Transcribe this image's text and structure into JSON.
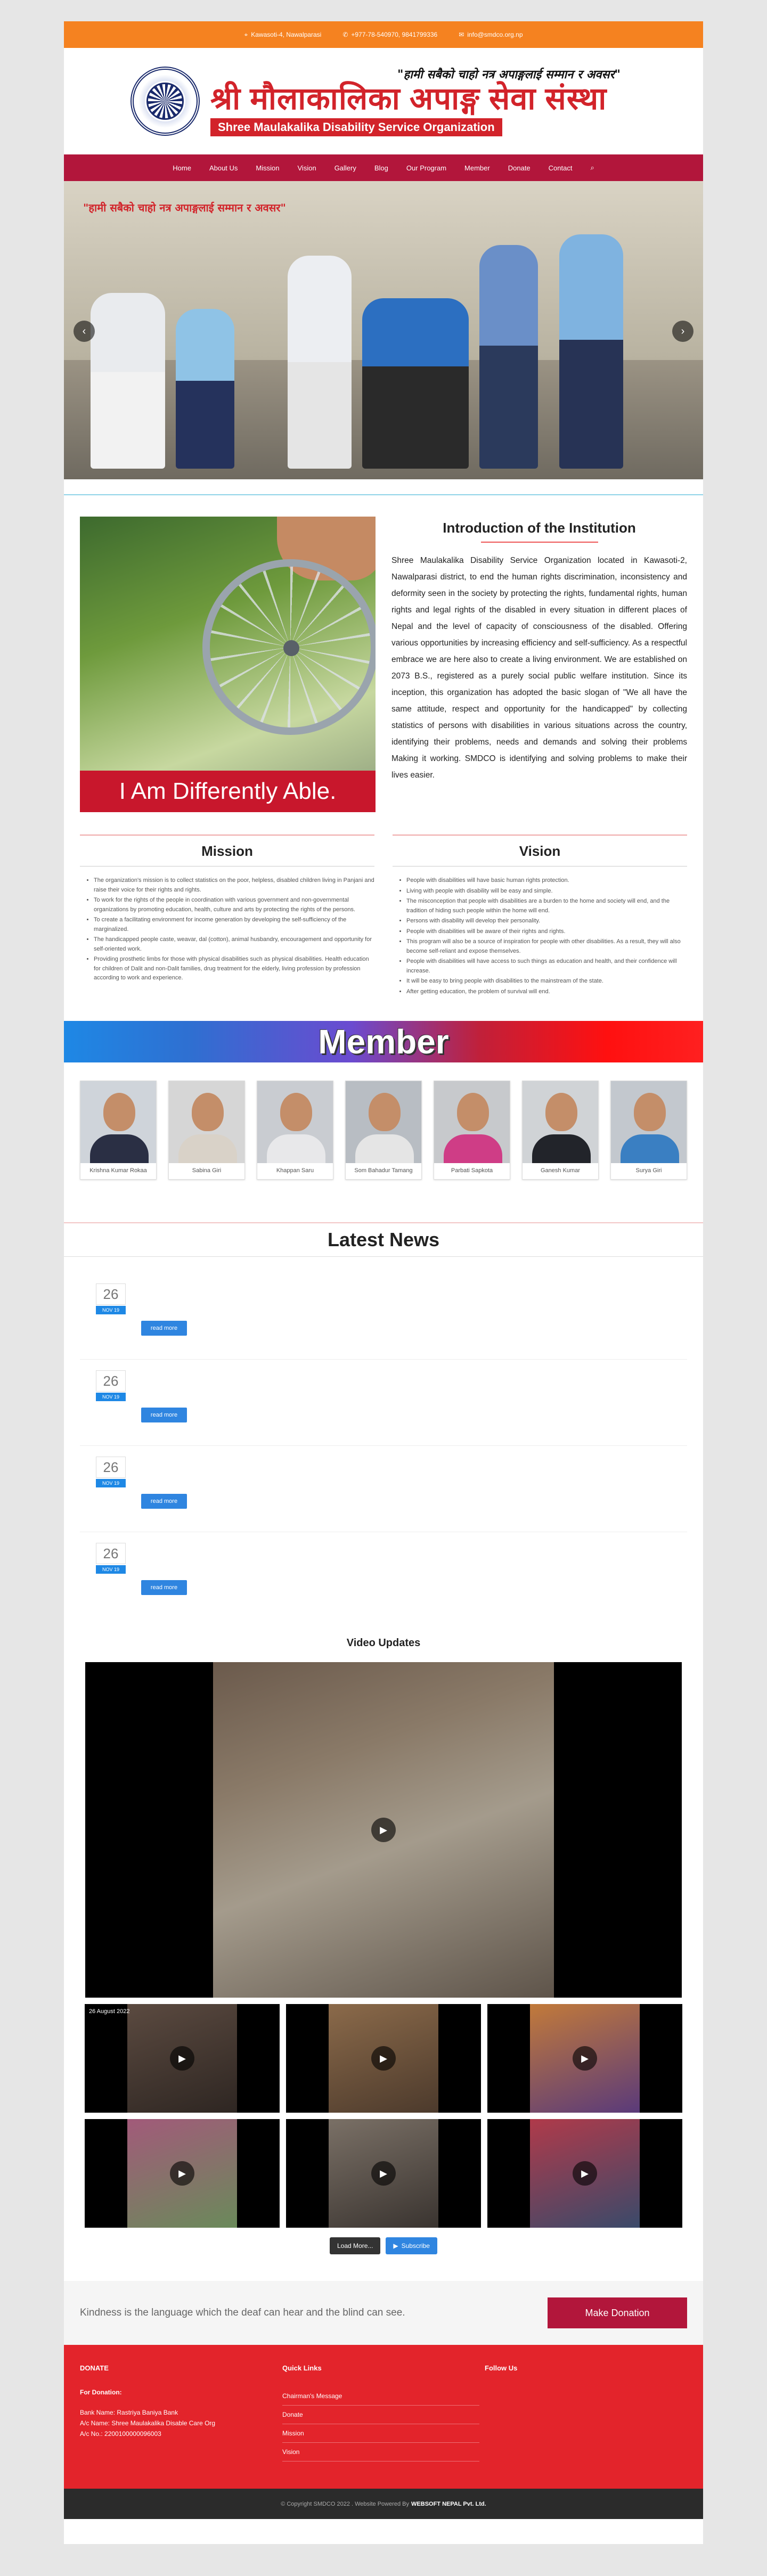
{
  "topbar": {
    "address": "Kawasoti-4, Nawalparasi",
    "phone": "+977-78-540970, 9841799336",
    "email": "info@smdco.org.np"
  },
  "header": {
    "tagline": "\"हामी सबैको चाहो नत्र अपाङ्गलाई सम्मान र अवसर\"",
    "name_nepali": "श्री मौलाकालिका अपाङ्ग सेवा संस्था",
    "name_english": "Shree Maulakalika Disability Service Organization"
  },
  "nav": [
    "Home",
    "About Us",
    "Mission",
    "Vision",
    "Gallery",
    "Blog",
    "Our Program",
    "Member",
    "Donate",
    "Contact"
  ],
  "slider": {
    "quote": "\"हामी सबैको चाहो नत्र अपाङ्गलाई सम्मान र अवसर\""
  },
  "intro": {
    "image_caption": "I Am Differently Able.",
    "title": "Introduction of the Institution",
    "body": "Shree Maulakalika Disability Service Organization located in Kawasoti-2, Nawalparasi district, to end the human rights discrimination, inconsistency and deformity seen in the society by protecting the rights, fundamental rights, human rights and legal rights of the disabled in every situation in different places of Nepal and the level of capacity of consciousness of the disabled. Offering various opportunities by increasing efficiency and self-sufficiency. As a respectful embrace we are here also to create a living environment. We are established on 2073 B.S., registered as a purely social public welfare institution. Since its inception, this organization has adopted the basic slogan of \"We all have the same attitude, respect and opportunity for the handicapped\" by collecting statistics of persons with disabilities in various situations across the country, identifying their problems, needs and demands and solving their problems Making it working. SMDCO is identifying and solving problems to make their lives easier."
  },
  "mission": {
    "title": "Mission",
    "items": [
      "The organization's mission is to collect statistics on the poor, helpless, disabled children living in Panjani and raise their voice for their rights and rights.",
      "To work for the rights of the people in coordination with various government and non-governmental organizations by promoting education, health, culture and arts by protecting the rights of the persons.",
      "To create a facilitating environment for income generation by developing the self-sufficiency of the marginalized.",
      "The handicapped people caste, weavar, dal (cotton), animal husbandry, encouragement and opportunity for self-oriented work.",
      "Providing prosthetic limbs for those with physical disabilities such as physical disabilities. Health education for children of Dalit and non-Dalit families, drug treatment for the elderly, living profession by profession according to work and experience."
    ]
  },
  "vision": {
    "title": "Vision",
    "items": [
      "People with disabilities will have basic human rights protection.",
      "Living with people with disability will be easy and simple.",
      "The misconception that people with disabilities are a burden to the home and society will end, and the tradition of hiding such people within the home will end.",
      "Persons with disability will develop their personality.",
      "People with disabilities will be aware of their rights and rights.",
      "This program will also be a source of inspiration for people with other disabilities. As a result, they will also become self-reliant and expose themselves.",
      "People with disabilities will have access to such things as education and health, and their confidence will increase.",
      "It will be easy to bring people with disabilities to the mainstream of the state.",
      "After getting education, the problem of survival will end."
    ]
  },
  "member": {
    "title": "Member",
    "members": [
      {
        "name": "Krishna Kumar Rokaa",
        "shirt": "#2a2f44",
        "bg": "#cfd4da"
      },
      {
        "name": "Sabina Giri",
        "shirt": "#d9d2c8",
        "bg": "#d6d6d6"
      },
      {
        "name": "Khappan Saru",
        "shirt": "#e8e8ea",
        "bg": "#c9ccd1"
      },
      {
        "name": "Som Bahadur Tamang",
        "shirt": "#e5e5e5",
        "bg": "#b8bdc3"
      },
      {
        "name": "Parbati Sapkota",
        "shirt": "#cf3d86",
        "bg": "#c7c9cc"
      },
      {
        "name": "Ganesh Kumar",
        "shirt": "#22242a",
        "bg": "#d0d3d6"
      },
      {
        "name": "Surya Giri",
        "shirt": "#3a7fc2",
        "bg": "#c3c8ce"
      }
    ]
  },
  "news": {
    "title": "Latest News",
    "read_more": "read more",
    "items": [
      {
        "day": "26",
        "month": "NOV 19"
      },
      {
        "day": "26",
        "month": "NOV 19"
      },
      {
        "day": "26",
        "month": "NOV 19"
      },
      {
        "day": "26",
        "month": "NOV 19"
      }
    ]
  },
  "video": {
    "title": "Video Updates",
    "thumb_date": "26 August 2022",
    "load_more": "Load More...",
    "subscribe": "Subscribe"
  },
  "donate": {
    "message": "Kindness is the language which the deaf can hear and the blind can see.",
    "button": "Make Donation"
  },
  "footer": {
    "donate_heading": "DONATE",
    "for_donation": "For Donation:",
    "bank": "Bank Name: Rastriya Baniya Bank",
    "ac_name": "A/c Name: Shree Maulakalika Disable Care Org",
    "ac_no": "A/c No.: 2200100000096003",
    "quick_heading": "Quick Links",
    "links": [
      "Chairman's Message",
      "Donate",
      "Mission",
      "Vision"
    ],
    "follow_heading": "Follow Us"
  },
  "copyright": {
    "text": "© Copyright SMDCO 2022 . Website Powered By",
    "company": "WEBSOFT NEPAL Pvt. Ltd."
  },
  "colors": {
    "topbar": "#f58220",
    "nav": "#b2163b",
    "brand_red": "#d2232a",
    "footer": "#e3242b"
  }
}
